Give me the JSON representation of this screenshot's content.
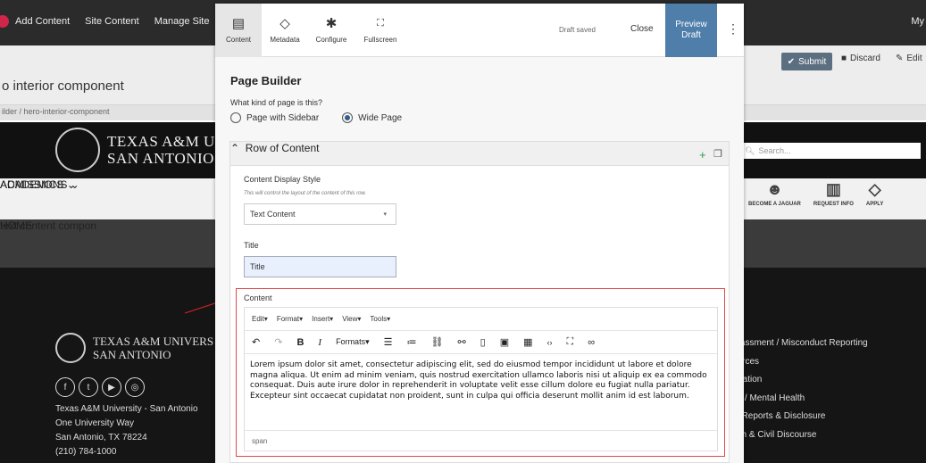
{
  "admin_bar": {
    "items": [
      "Add Content",
      "Site Content",
      "Manage Site"
    ],
    "user": "My"
  },
  "page": {
    "title_fragment": "o interior component",
    "breadcrumb": "ilder / hero-interior-component",
    "actions": {
      "submit": "Submit",
      "discard": "Discard",
      "edit": "Edit"
    }
  },
  "site": {
    "brand_line1": "TEXAS A&M U",
    "brand_line2": "SAN ANTONIO",
    "search_placeholder": "Search...",
    "nav": [
      "ACADEMICS",
      "ADMISSIONS"
    ],
    "quick_links": [
      {
        "label": "BECOME A JAGUAR",
        "icon": "jaguar-icon"
      },
      {
        "label": "REQUEST INFO",
        "icon": "books-icon"
      },
      {
        "label": "APPLY",
        "icon": "graduation-cap-icon"
      }
    ],
    "hero_home": "HOME",
    "hero_title": "text content compon"
  },
  "footer": {
    "brand_line1": "TEXAS A&M UNIVERS",
    "brand_line2": "SAN ANTONIO",
    "address": [
      "Texas A&M University - San Antonio",
      "One University Way",
      "San Antonio, TX 78224",
      "(210) 784-1000"
    ],
    "links": [
      "arassment / Misconduct Reporting",
      "ources",
      "rmation",
      "ng / Mental Health",
      "ct Reports & Disclosure",
      "ech & Civil Discourse"
    ]
  },
  "panel": {
    "tabs": [
      {
        "label": "Content",
        "icon": "document-icon"
      },
      {
        "label": "Metadata",
        "icon": "tag-icon"
      },
      {
        "label": "Configure",
        "icon": "gear-icon"
      },
      {
        "label": "Fullscreen",
        "icon": "expand-icon"
      }
    ],
    "draft_status": "Draft saved",
    "close": "Close",
    "preview_line1": "Preview",
    "preview_line2": "Draft",
    "heading": "Page Builder",
    "question": "What kind of page is this?",
    "page_types": [
      "Page with Sidebar",
      "Wide Page"
    ],
    "row_title": "Row of Content",
    "display_style_label": "Content Display Style",
    "display_style_hint": "This will control the layout of the content of this row.",
    "display_style_value": "Text Content",
    "title_label": "Title",
    "title_value": "Title",
    "content_label": "Content",
    "editor_menu": [
      "Edit▾",
      "Format▾",
      "Insert▾",
      "View▾",
      "Tools▾"
    ],
    "formats": "Formats▾",
    "body": "Lorem ipsum dolor sit amet, consectetur adipiscing elit, sed do eiusmod tempor incididunt ut labore et dolore magna aliqua. Ut enim ad minim veniam, quis nostrud exercitation ullamco laboris nisi ut aliquip ex ea commodo consequat. Duis aute irure dolor in reprehenderit in voluptate velit esse cillum dolore eu fugiat nulla pariatur. Excepteur sint occaecat cupidatat non proident, sunt in culpa qui officia deserunt mollit anim id est laborum.",
    "status_path": "span"
  }
}
